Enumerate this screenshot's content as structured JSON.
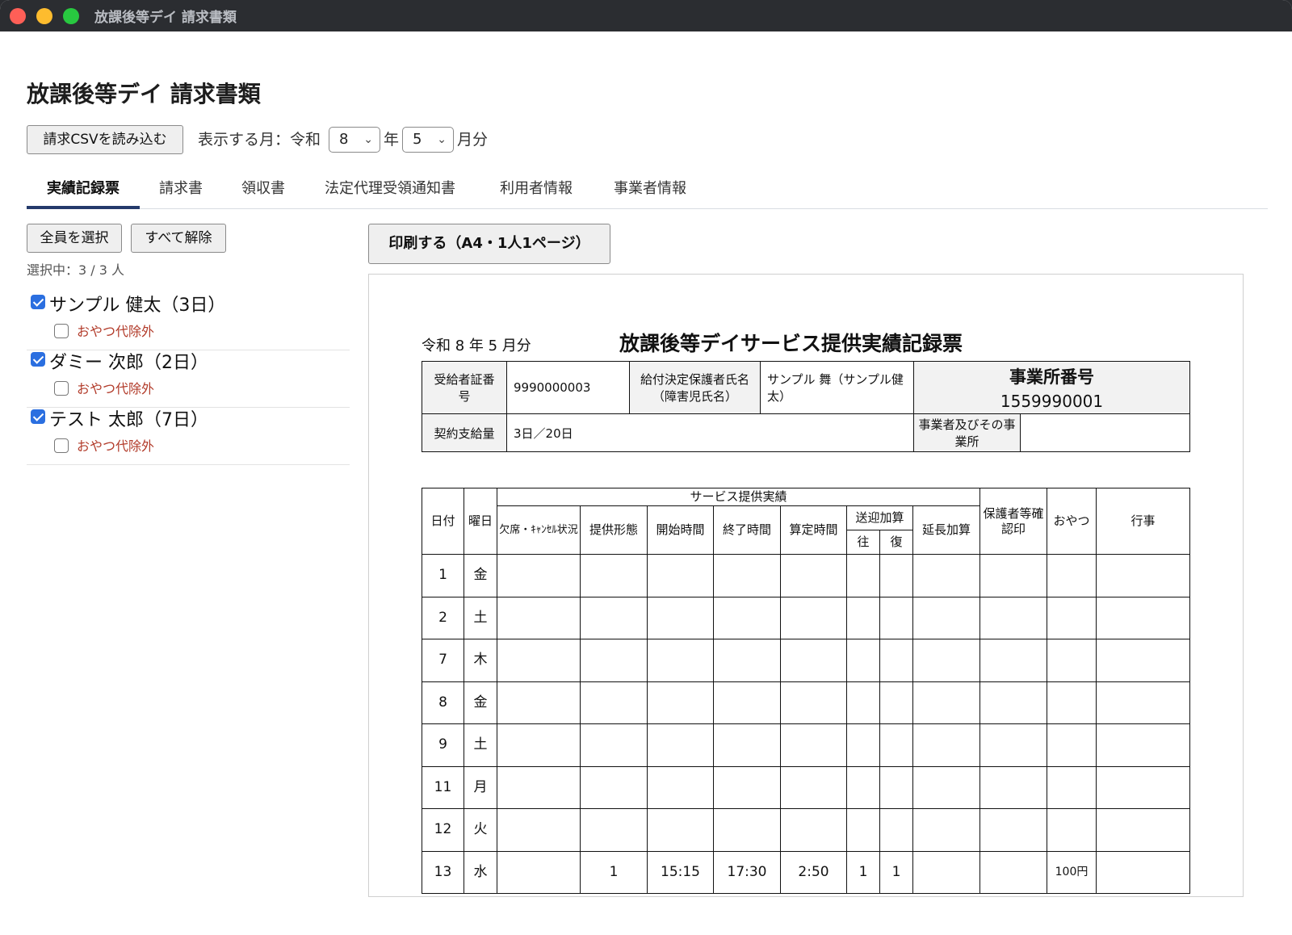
{
  "window": {
    "title": "放課後等デイ 請求書類"
  },
  "page": {
    "title": "放課後等デイ 請求書類"
  },
  "toolbar": {
    "load_csv_label": "請求CSVを読み込む",
    "month_prefix": "表示する月：令和",
    "year_value": "8",
    "year_unit": "年",
    "month_value": "5",
    "month_unit": "月分"
  },
  "tabs": [
    {
      "label": "実績記録票",
      "active": true
    },
    {
      "label": "請求書",
      "active": false
    },
    {
      "label": "領収書",
      "active": false
    },
    {
      "label": "法定代理受領通知書",
      "active": false
    },
    {
      "label": "利用者情報",
      "active": false
    },
    {
      "label": "事業者情報",
      "active": false
    }
  ],
  "left": {
    "select_all_label": "全員を選択",
    "clear_all_label": "すべて解除",
    "selected_count": "選択中：3 / 3 人",
    "snack_exclude_label": "おやつ代除外",
    "people": [
      {
        "name": "サンプル 健太（3日）",
        "checked": true
      },
      {
        "name": "ダミー 次郎（2日）",
        "checked": true
      },
      {
        "name": "テスト 太郎（7日）",
        "checked": true
      }
    ]
  },
  "print_label": "印刷する（A4・1人1ページ）",
  "doc": {
    "month_label": "令和 8 年 5 月分",
    "title": "放課後等デイサービス提供実績記録票",
    "recipient_cert_label": "受給者証番　　号",
    "recipient_cert_number": "9990000003",
    "guardian_label": "給付決定保護者氏名（障害児氏名）",
    "guardian_name": "サンプル 舞（サンプル健太）",
    "office_number_label": "事業所番号",
    "office_number": "1559990001",
    "contract_label": "契約支給量",
    "contract_value": "3日／20日",
    "provider_label": "事業者及びその事業所",
    "provider_value": "",
    "columns": {
      "date": "日付",
      "weekday": "曜日",
      "service_group": "サービス提供実績",
      "absence": "欠席・ｷｬﾝｾﾙ状況",
      "form": "提供形態",
      "start": "開始時間",
      "end": "終了時間",
      "calc": "算定時間",
      "transport": "送迎加算",
      "transport_go": "往",
      "transport_back": "復",
      "extension": "延長加算",
      "guardian_seal": "保護者等確認印",
      "snack": "おやつ",
      "event": "行事"
    },
    "rows": [
      {
        "day": "1",
        "weekday": "金",
        "absence": "",
        "form": "",
        "start": "",
        "end": "",
        "calc": "",
        "go": "",
        "back": "",
        "ext": "",
        "seal": "",
        "snack": "",
        "event": ""
      },
      {
        "day": "2",
        "weekday": "土",
        "absence": "",
        "form": "",
        "start": "",
        "end": "",
        "calc": "",
        "go": "",
        "back": "",
        "ext": "",
        "seal": "",
        "snack": "",
        "event": ""
      },
      {
        "day": "7",
        "weekday": "木",
        "absence": "",
        "form": "",
        "start": "",
        "end": "",
        "calc": "",
        "go": "",
        "back": "",
        "ext": "",
        "seal": "",
        "snack": "",
        "event": ""
      },
      {
        "day": "8",
        "weekday": "金",
        "absence": "",
        "form": "",
        "start": "",
        "end": "",
        "calc": "",
        "go": "",
        "back": "",
        "ext": "",
        "seal": "",
        "snack": "",
        "event": ""
      },
      {
        "day": "9",
        "weekday": "土",
        "absence": "",
        "form": "",
        "start": "",
        "end": "",
        "calc": "",
        "go": "",
        "back": "",
        "ext": "",
        "seal": "",
        "snack": "",
        "event": ""
      },
      {
        "day": "11",
        "weekday": "月",
        "absence": "",
        "form": "",
        "start": "",
        "end": "",
        "calc": "",
        "go": "",
        "back": "",
        "ext": "",
        "seal": "",
        "snack": "",
        "event": ""
      },
      {
        "day": "12",
        "weekday": "火",
        "absence": "",
        "form": "",
        "start": "",
        "end": "",
        "calc": "",
        "go": "",
        "back": "",
        "ext": "",
        "seal": "",
        "snack": "",
        "event": ""
      },
      {
        "day": "13",
        "weekday": "水",
        "absence": "",
        "form": "1",
        "start": "15:15",
        "end": "17:30",
        "calc": "2:50",
        "go": "1",
        "back": "1",
        "ext": "",
        "seal": "",
        "snack": "100円",
        "event": ""
      }
    ]
  },
  "colors": {
    "checkbox": "#2b6fe0",
    "tab_underline": "#243a6b",
    "snack_label": "#b23b2a"
  }
}
